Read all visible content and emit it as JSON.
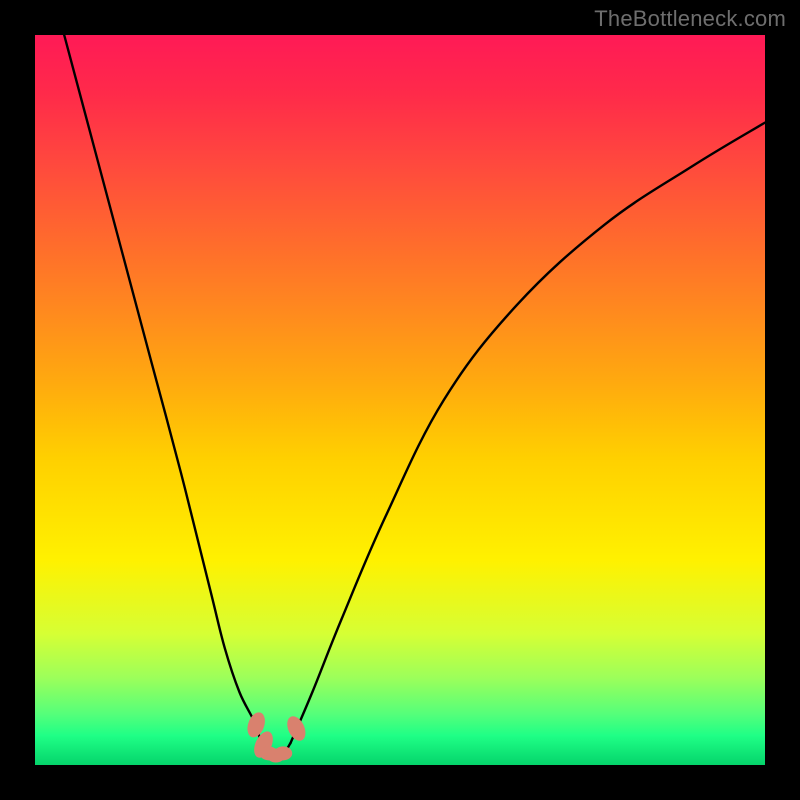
{
  "attribution": "TheBottleneck.com",
  "chart_data": {
    "type": "line",
    "title": "",
    "xlabel": "",
    "ylabel": "",
    "xlim": [
      0,
      100
    ],
    "ylim": [
      0,
      100
    ],
    "series": [
      {
        "name": "left-curve",
        "x": [
          4,
          8,
          12,
          16,
          20,
          24,
          26,
          28,
          30,
          31
        ],
        "values": [
          100,
          85,
          70,
          55,
          40,
          24,
          16,
          10,
          6,
          3
        ]
      },
      {
        "name": "bottom-curve",
        "x": [
          31,
          32,
          33,
          34,
          35
        ],
        "values": [
          3,
          1.5,
          1.2,
          1.5,
          3
        ]
      },
      {
        "name": "right-curve",
        "x": [
          35,
          38,
          42,
          48,
          56,
          66,
          78,
          90,
          100
        ],
        "values": [
          3,
          10,
          20,
          34,
          50,
          63,
          74,
          82,
          88
        ]
      }
    ],
    "markers": [
      {
        "name": "bead-left-top",
        "x": 30.3,
        "y": 5.5
      },
      {
        "name": "bead-left-bottom",
        "x": 31.3,
        "y": 2.8
      },
      {
        "name": "bead-right-top",
        "x": 35.8,
        "y": 5.0
      },
      {
        "name": "bead-mid-1",
        "x": 32.0,
        "y": 1.6
      },
      {
        "name": "bead-mid-2",
        "x": 33.0,
        "y": 1.3
      },
      {
        "name": "bead-mid-3",
        "x": 34.0,
        "y": 1.6
      }
    ],
    "color_scale": {
      "top": "#ff1a56",
      "mid": "#fff100",
      "bottom": "#05d46b"
    }
  }
}
